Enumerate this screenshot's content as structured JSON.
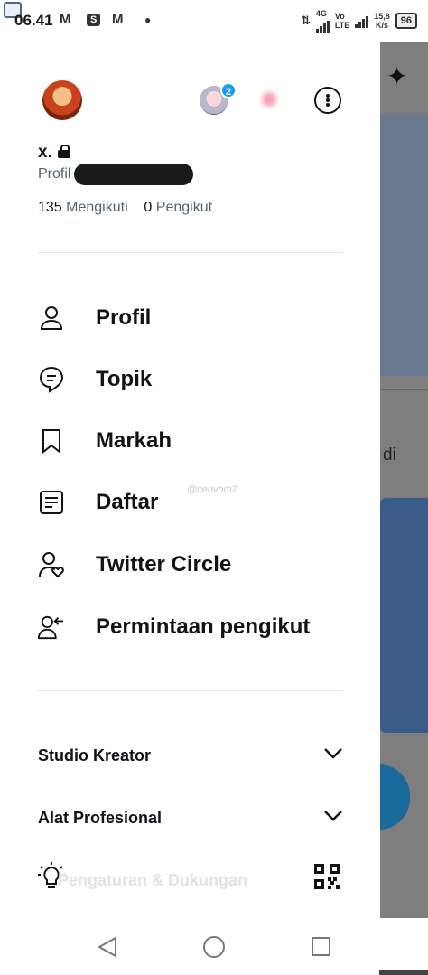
{
  "status_bar": {
    "time": "06.41",
    "network_1": "4G",
    "network_2_line1": "Vo",
    "network_2_line2": "LTE",
    "speed_value": "15,8",
    "speed_unit": "K/s",
    "battery": "96",
    "notification_icons": [
      "gmail-icon",
      "shopee-icon",
      "gmail-icon",
      "dot-icon"
    ]
  },
  "profile": {
    "name": "x.",
    "handle_prefix": "Profil",
    "following_count": "135",
    "following_label": "Mengikuti",
    "followers_count": "0",
    "followers_label": "Pengikut",
    "account_badge_count": "2"
  },
  "menu": {
    "items": [
      {
        "label": "Profil",
        "icon": "person-icon"
      },
      {
        "label": "Topik",
        "icon": "topic-icon"
      },
      {
        "label": "Markah",
        "icon": "bookmark-icon"
      },
      {
        "label": "Daftar",
        "icon": "list-icon"
      },
      {
        "label": "Twitter Circle",
        "icon": "circle-people-icon"
      },
      {
        "label": "Permintaan pengikut",
        "icon": "follow-request-icon"
      }
    ]
  },
  "sections": {
    "studio": "Studio Kreator",
    "pro_tools": "Alat Profesional",
    "settings": "Pengaturan & Dukungan"
  },
  "watermark": "@cenvom7",
  "background": {
    "partial_text": "di"
  }
}
